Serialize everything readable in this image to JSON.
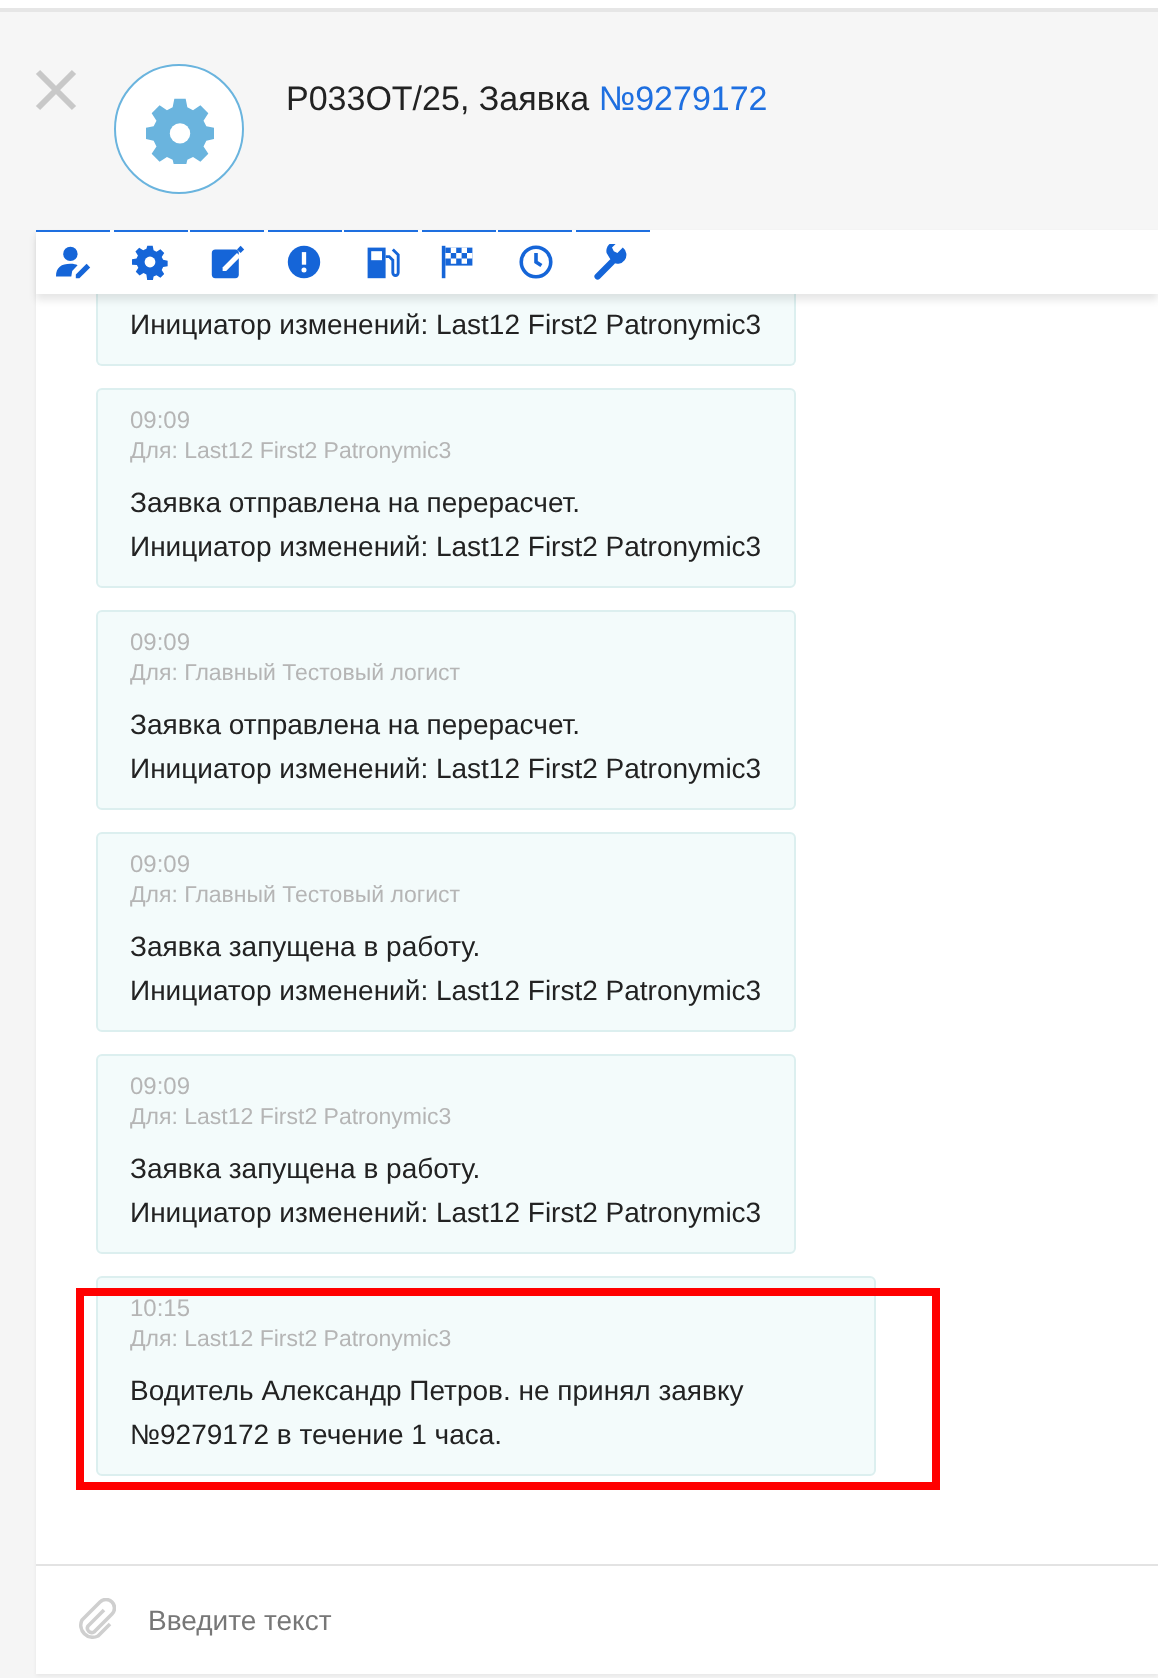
{
  "header": {
    "title": "P033OT/25, Заявка ",
    "order_link": "№9279172"
  },
  "toolbar": [
    {
      "kind": "user-edit"
    },
    {
      "kind": "gear"
    },
    {
      "kind": "edit"
    },
    {
      "kind": "alert"
    },
    {
      "kind": "fuel"
    },
    {
      "kind": "flag"
    },
    {
      "kind": "clock"
    },
    {
      "kind": "wrench"
    }
  ],
  "messages": [
    {
      "kind": "partial",
      "lines": [
        "Инициатор изменений: Last12 First2 Patronymic3"
      ],
      "highlighted": false
    },
    {
      "kind": "full",
      "time": "09:09",
      "recipient": "Для: Last12 First2 Patronymic3",
      "lines": [
        "Заявка отправлена на перерасчет.",
        "Инициатор изменений: Last12 First2 Patronymic3"
      ],
      "highlighted": false
    },
    {
      "kind": "full",
      "time": "09:09",
      "recipient": "Для: Главный Тестовый логист",
      "lines": [
        "Заявка отправлена на перерасчет.",
        "Инициатор изменений: Last12 First2 Patronymic3"
      ],
      "highlighted": false
    },
    {
      "kind": "full",
      "time": "09:09",
      "recipient": "Для: Главный Тестовый логист",
      "lines": [
        "Заявка запущена в работу.",
        "Инициатор изменений: Last12 First2 Patronymic3"
      ],
      "highlighted": false
    },
    {
      "kind": "full",
      "time": "09:09",
      "recipient": "Для: Last12 First2 Patronymic3",
      "lines": [
        "Заявка запущена в работу.",
        "Инициатор изменений: Last12 First2 Patronymic3"
      ],
      "highlighted": false
    },
    {
      "kind": "full",
      "time": "10:15",
      "recipient": "Для: Last12 First2 Patronymic3",
      "lines": [
        "Водитель Александр Петров. не принял заявку №9279172 в течение 1 часа."
      ],
      "highlighted": true
    }
  ],
  "composer": {
    "placeholder": "Введите текст"
  }
}
